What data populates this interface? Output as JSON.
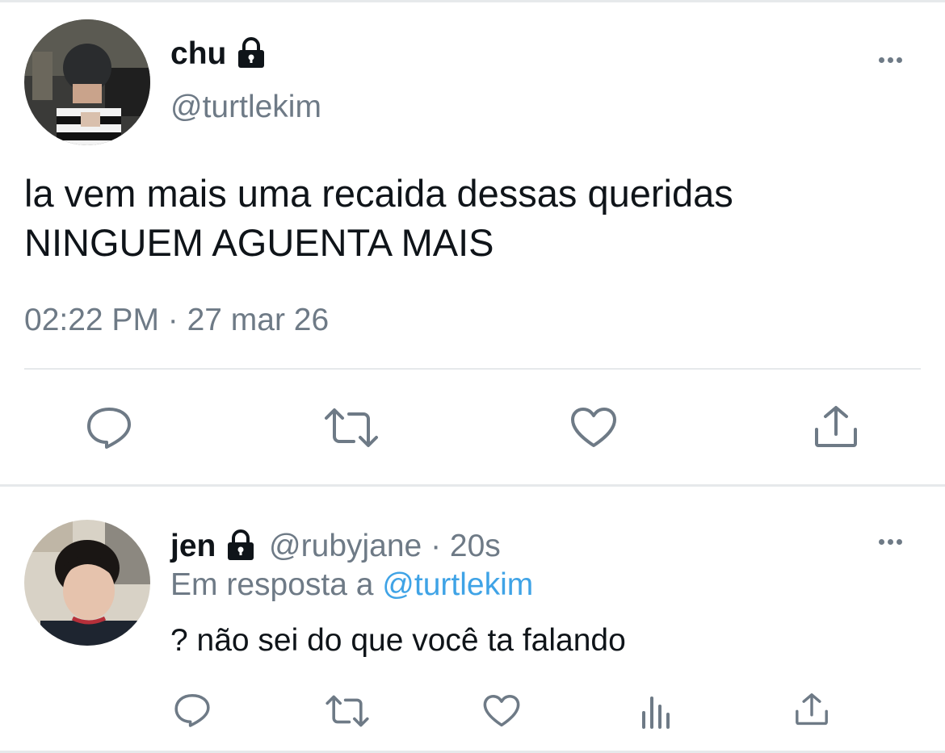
{
  "main_tweet": {
    "author_name": "chu",
    "handle": "@turtlekim",
    "text_line1": "la vem mais uma recaida dessas queridas",
    "text_line2": "NINGUEM AGUENTA MAIS",
    "timestamp": "02:22 PM · 27 mar 26",
    "locked": true,
    "actions": [
      "reply-icon",
      "retweet-icon",
      "like-icon",
      "share-icon"
    ]
  },
  "reply": {
    "author_name": "jen",
    "handle": "@rubyjane",
    "separator": " · ",
    "time": "20s",
    "reply_prefix": "Em resposta a ",
    "reply_to": "@turtlekim",
    "text": "? não sei do que você ta falando",
    "locked": true,
    "actions": [
      "reply-icon",
      "retweet-icon",
      "like-icon",
      "analytics-icon",
      "share-icon"
    ]
  },
  "colors": {
    "text": "#0f1419",
    "secondary": "#6e7a86",
    "link": "#3fa3e6",
    "divider": "#e6e9eb"
  }
}
